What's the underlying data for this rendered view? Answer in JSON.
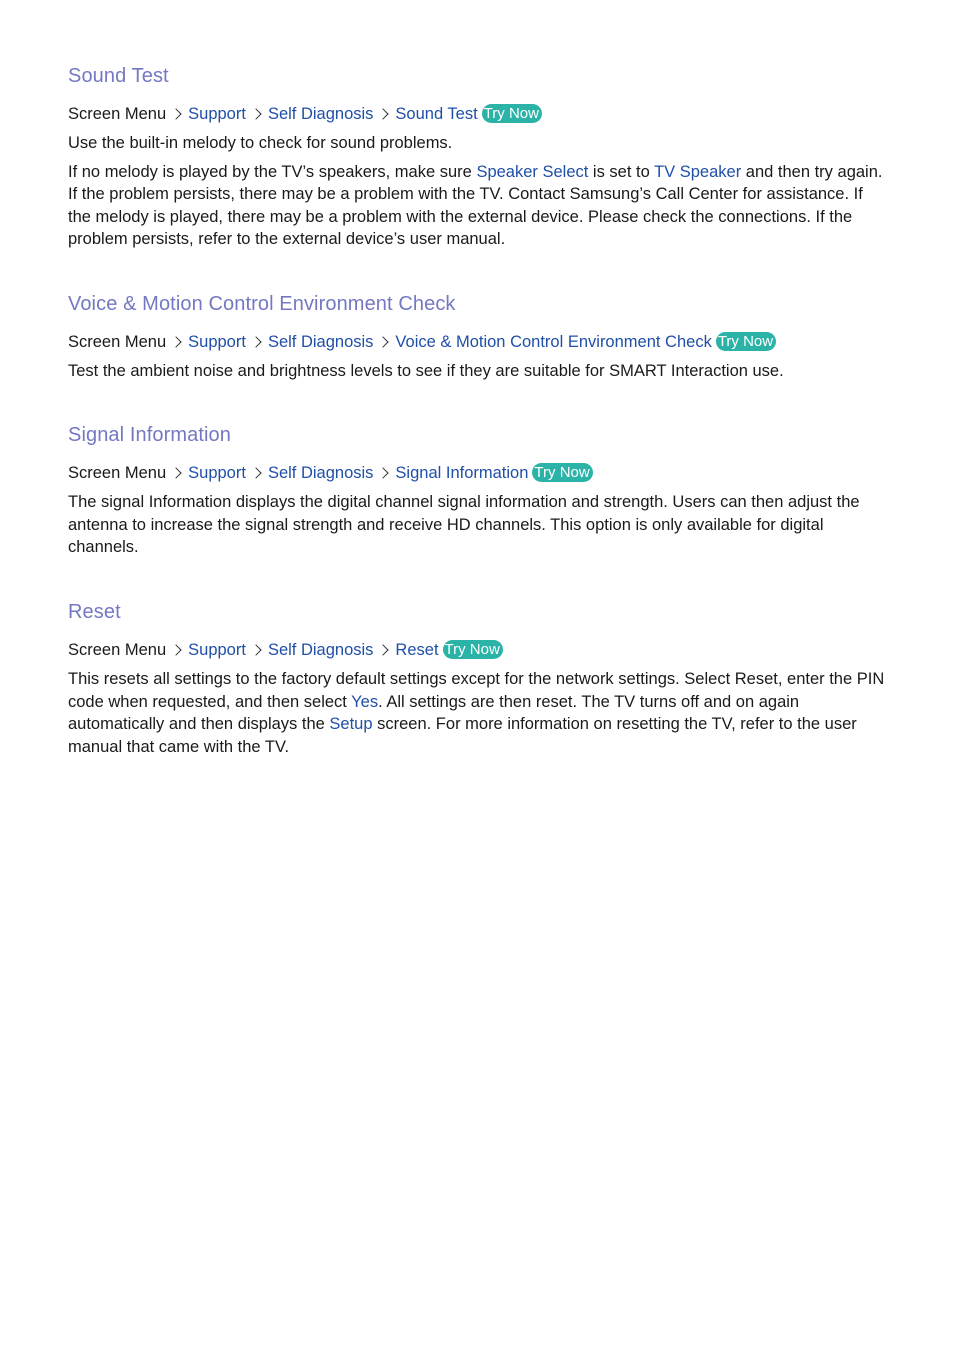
{
  "sections": [
    {
      "title": "Sound Test",
      "breadcrumb": {
        "root": "Screen Menu",
        "items": [
          "Support",
          "Self Diagnosis",
          "Sound Test"
        ],
        "badge": "Try Now"
      },
      "paragraphs": [
        {
          "parts": [
            "Use the built-in melody to check for sound problems."
          ]
        },
        {
          "parts": [
            "If no melody is played by the TV’s speakers, make sure ",
            "Speaker Select",
            " is set to ",
            "TV Speaker",
            " and then try again. If the problem persists, there may be a problem with the TV. Contact Samsung’s Call Center for assistance. If the melody is played, there may be a problem with the external device. Please check the connections. If the problem persists, refer to the external device’s user manual."
          ]
        }
      ]
    },
    {
      "title": "Voice & Motion Control Environment Check",
      "breadcrumb": {
        "root": "Screen Menu",
        "items": [
          "Support",
          "Self Diagnosis",
          "Voice & Motion Control Environment Check"
        ],
        "badge": "Try Now"
      },
      "paragraphs": [
        {
          "parts": [
            "Test the ambient noise and brightness levels to see if they are suitable for SMART Interaction use."
          ]
        }
      ]
    },
    {
      "title": "Signal Information",
      "breadcrumb": {
        "root": "Screen Menu",
        "items": [
          "Support",
          "Self Diagnosis",
          "Signal Information"
        ],
        "badge": "Try Now"
      },
      "paragraphs": [
        {
          "parts": [
            "The signal Information displays the digital channel signal information and strength. Users can then adjust the antenna to increase the signal strength and receive HD channels. This option is only available for digital channels."
          ]
        }
      ]
    },
    {
      "title": "Reset",
      "breadcrumb": {
        "root": "Screen Menu",
        "items": [
          "Support",
          "Self Diagnosis",
          "Reset"
        ],
        "badge": "Try Now"
      },
      "paragraphs": [
        {
          "parts": [
            "This resets all settings to the factory default settings except for the network settings. Select Reset, enter the PIN code when requested, and then select ",
            "Yes",
            ". All settings are then reset. The TV turns off and on again automatically and then displays the ",
            "Setup",
            " screen. For more information on resetting the TV, refer to the user manual that came with the TV."
          ]
        }
      ]
    }
  ],
  "colors": {
    "heading": "#7478c2",
    "link": "#1f4fa8",
    "badge": "#2bb3a7",
    "text": "#1a1a1a"
  }
}
